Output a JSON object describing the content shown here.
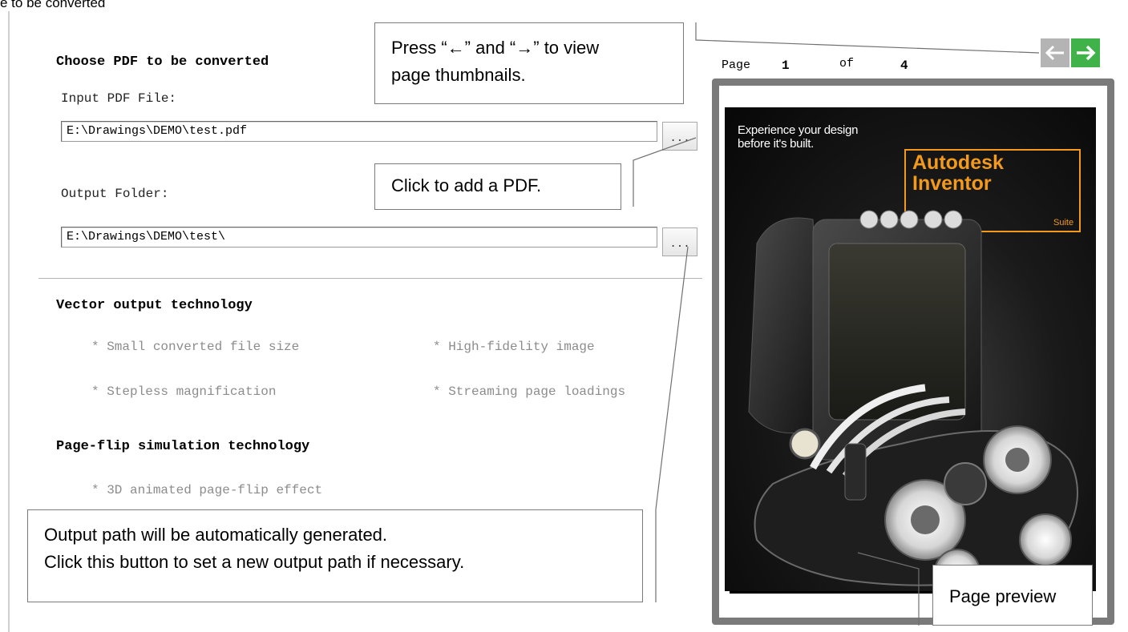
{
  "document_title_fragment": "e to be converted",
  "choose_pdf": {
    "title": "Choose PDF to be converted",
    "input_label": "Input PDF File:",
    "input_value": "E:\\Drawings\\DEMO\\test.pdf",
    "browse_label": "...",
    "output_label": "Output Folder:",
    "output_value": "E:\\Drawings\\DEMO\\test\\",
    "output_browse_label": "..."
  },
  "vector_section": {
    "title": "Vector output technology",
    "features": [
      "* Small converted file size",
      "* High-fidelity image",
      "* Stepless magnification",
      "* Streaming page loadings"
    ]
  },
  "pageflip_section": {
    "title": "Page-flip simulation technology",
    "features": [
      "* 3D animated page-flip effect"
    ]
  },
  "preview": {
    "page_label": "Page",
    "current_page": "1",
    "of_label": "of",
    "total_pages": "4",
    "image_texts": {
      "tagline_line1": "Experience your design",
      "tagline_line2": "before it's built.",
      "brand_line1": "Autodesk",
      "brand_line2": "Inventor",
      "suite": "Suite"
    }
  },
  "callouts": {
    "nav_hint_line1": "Press “←” and “→” to view",
    "nav_hint_line2": "page thumbnails.",
    "add_pdf": "Click to add a PDF.",
    "output_line1": "Output path will be automatically generated.",
    "output_line2": "Click this button to set a new output path if necessary.",
    "page_preview": "Page preview"
  },
  "colors": {
    "nav_prev_bg": "#b4b4b4",
    "nav_next_bg": "#3fb24a",
    "frame_border": "#7a7a7a",
    "brand_orange": "#f39a1d"
  },
  "icons": {
    "prev": "arrow-left-icon",
    "next": "arrow-right-icon"
  }
}
